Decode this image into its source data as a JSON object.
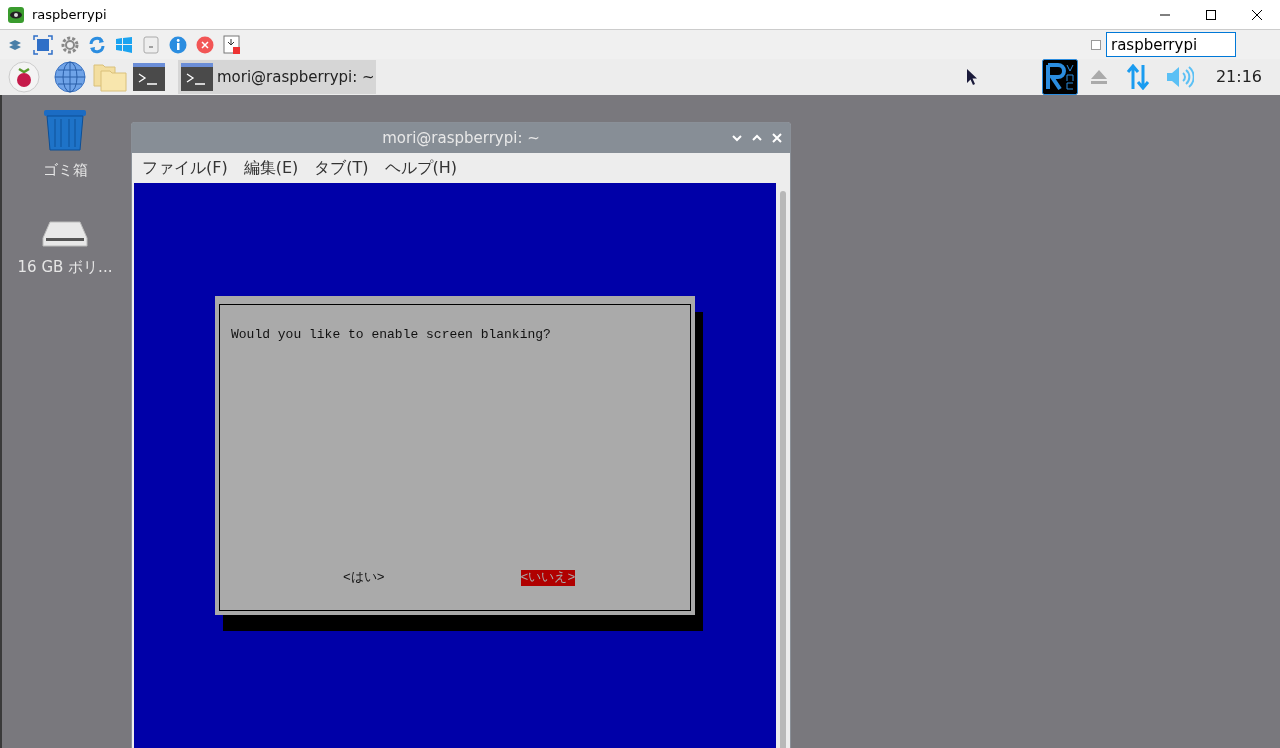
{
  "viewer": {
    "title": "raspberrypi",
    "host_field": {
      "value": "raspberrypi"
    },
    "checkbox": {
      "checked": false
    }
  },
  "taskbar": {
    "task": {
      "label": "mori@raspberrypi: ~",
      "selected": true
    },
    "clock": "21:16"
  },
  "desktop_icons": [
    {
      "kind": "trash",
      "label": "ゴミ箱"
    },
    {
      "kind": "drive",
      "label": "16 GB ボリ..."
    }
  ],
  "terminal": {
    "title": "mori@raspberrypi: ~",
    "menu": [
      "ファイル(F)",
      "編集(E)",
      "タブ(T)",
      "ヘルプ(H)"
    ],
    "dialog": {
      "message": "Would you like to enable screen blanking?",
      "buttons": [
        {
          "label": "<はい>",
          "selected": false
        },
        {
          "label": "<いいえ>",
          "selected": true
        }
      ]
    }
  }
}
